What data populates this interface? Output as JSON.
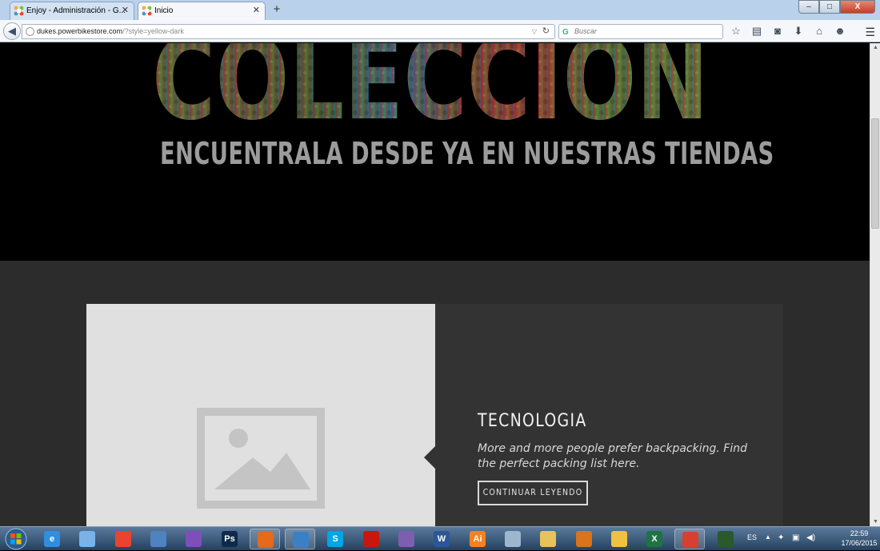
{
  "browser": {
    "tabs": [
      {
        "label": "Enjoy - Administración - G...",
        "active": false
      },
      {
        "label": "Inicio",
        "active": true
      }
    ],
    "new_tab": "+",
    "url_host": "dukes.powerbikestore.com",
    "url_path": "/?style=yellow-dark",
    "search_placeholder": "Buscar",
    "window_controls": {
      "minimize": "–",
      "maximize": "□",
      "close": "X"
    },
    "toolbar_icons": [
      "star-icon",
      "reading-list-icon",
      "pocket-icon",
      "download-icon",
      "home-icon",
      "chat-icon"
    ]
  },
  "hero": {
    "title": "COLECCION",
    "subtitle": "ENCUENTRALA DESDE YA EN NUESTRAS TIENDAS"
  },
  "card": {
    "title": "TECNOLOGIA",
    "text": "More and more people prefer backpacking. Find the perfect packing list here.",
    "button_label": "CONTINUAR LEYENDO"
  },
  "taskbar": {
    "apps": [
      {
        "name": "internet-explorer-icon",
        "glyph": "e",
        "color": "#2f8ee0"
      },
      {
        "name": "notes-icon",
        "glyph": "",
        "color": "#7ab2e8"
      },
      {
        "name": "chrome-icon",
        "glyph": "",
        "color": "#e9442f"
      },
      {
        "name": "control-panel-icon",
        "glyph": "",
        "color": "#4f83c0"
      },
      {
        "name": "bittorrent-icon",
        "glyph": "",
        "color": "#7e4fb8"
      },
      {
        "name": "photoshop-icon",
        "glyph": "Ps",
        "color": "#0d2a4a"
      },
      {
        "name": "firefox-icon",
        "glyph": "",
        "color": "#e66a1a"
      },
      {
        "name": "paint-icon",
        "glyph": "",
        "color": "#3a80c7"
      },
      {
        "name": "skype-icon",
        "glyph": "S",
        "color": "#00a6e8"
      },
      {
        "name": "acrobat-icon",
        "glyph": "",
        "color": "#c8170f"
      },
      {
        "name": "visual-studio-icon",
        "glyph": "",
        "color": "#7d5fb0"
      },
      {
        "name": "word-icon",
        "glyph": "W",
        "color": "#2b5797"
      },
      {
        "name": "illustrator-icon",
        "glyph": "Ai",
        "color": "#f58220"
      },
      {
        "name": "calculator-icon",
        "glyph": "",
        "color": "#9fb6cf"
      },
      {
        "name": "explorer-icon",
        "glyph": "",
        "color": "#e8c35a"
      },
      {
        "name": "gimp-icon",
        "glyph": "",
        "color": "#d9741c"
      },
      {
        "name": "mail-icon",
        "glyph": "",
        "color": "#f0c040"
      },
      {
        "name": "excel-icon",
        "glyph": "X",
        "color": "#1f7244"
      },
      {
        "name": "cleaner-icon",
        "glyph": "",
        "color": "#d64030"
      },
      {
        "name": "task-manager-icon",
        "glyph": "",
        "color": "#2a5a2a"
      }
    ],
    "tray": {
      "language": "ES",
      "time": "22:59",
      "date": "17/06/2015"
    }
  }
}
